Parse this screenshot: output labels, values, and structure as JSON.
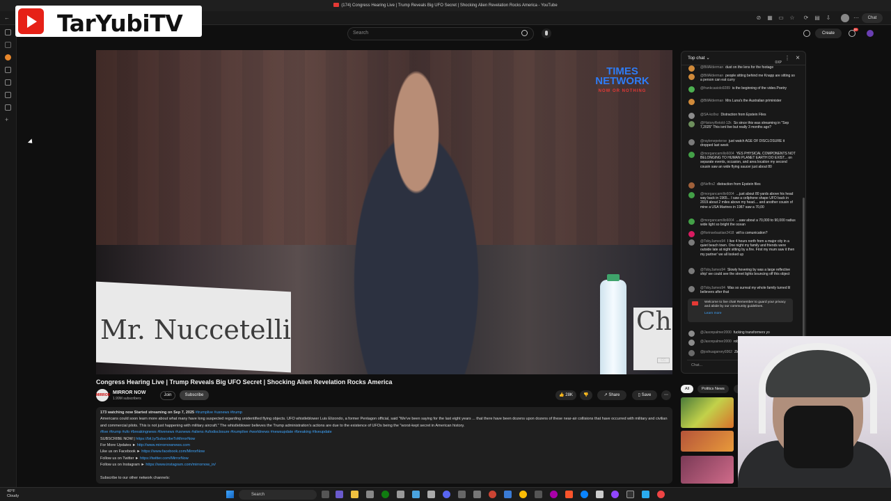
{
  "browser": {
    "window_title": "(174) Congress Hearing Live | Trump Reveals Big UFO Secret | Shocking Alien Revelation Rocks America - YouTube",
    "chat_button": "Chat"
  },
  "overlay": {
    "brand": "TarYubiTV"
  },
  "header": {
    "search_placeholder": "Search",
    "create_label": "Create",
    "notifications_count": "9+"
  },
  "video": {
    "nameplate": "Mr. Nuccetelli",
    "network_logo": "TIMES NETWORK",
    "network_tagline": "NOW OR NOTHING",
    "nameplate_partial": "Ch",
    "title": "Congress Hearing Live | Trump Reveals Big UFO Secret | Shocking Alien Revelation Rocks America"
  },
  "channel": {
    "avatar_text": "MIRROR",
    "name": "MIRROR NOW",
    "subscribers": "1.99M subscribers",
    "join_label": "Join",
    "subscribe_label": "Subscribe"
  },
  "actions": {
    "likes": "28K",
    "share_label": "Share",
    "save_label": "Save"
  },
  "description": {
    "meta": "173 watching now  Started streaming on Sep 7, 2025",
    "hashtags_top": "#trumplive #usnews #trump",
    "body": "Americans could soon learn more about what many have long suspected regarding unidentified flying objects. UFO whistleblower Luis Elizondo, a former Pentagon official, said \"We've been saying for the last eight years ... that there have been dozens upon dozens of these near-air collisions that have occurred with military and civilian and commercial pilots. This is not just happening with military aircraft.\" The whistleblower believes the Trump administration's actions are due to the existence of UFOs being the \"worst-kept secret in American history.",
    "hashtags": "#live #trump #ufo #breakingnews #livenews #usnews #aliens #ufodisclosure #trumplive #worldnews #newsupdate #breaking #liveupdate",
    "links": [
      {
        "label": "SUBSCRIBE NOW |",
        "url": "https://bit.ly/SubscribeToMirrorNow"
      },
      {
        "label": "For More Updates ►",
        "url": "http://www.mirrornownews.com"
      },
      {
        "label": "Like us on Facebook ►",
        "url": "https://www.facebook.com/MirrorNow"
      },
      {
        "label": "Follow us on Twitter ►",
        "url": "https://twitter.com/MirrorNow"
      },
      {
        "label": "Follow us on Instagram ►",
        "url": "https://www.instagram.com/mirrornow_in/"
      }
    ],
    "footer": "Subscribe to our other network channels:"
  },
  "chat": {
    "header": "Top chat",
    "xp": "0XP",
    "input_placeholder": "Chat...",
    "banner_text": "Welcome to live chat! Remember to guard your privacy and abide by our community guidelines.",
    "banner_link": "Learn more",
    "messages": [
      {
        "author": "@BillAlderman",
        "text": "dust on the lens for the footage",
        "color": "#d08a3a"
      },
      {
        "author": "@BillAlderman",
        "text": "people sitting behind me Knapp are sitting so a person can eat curry",
        "color": "#d08a3a"
      },
      {
        "author": "@frankcasiolo9289",
        "text": "is the beginning of the video.Poetry",
        "color": "#4caf50"
      },
      {
        "author": "@BillAlderman",
        "text": "Mrs Luna's the Australian priminister",
        "color": "#d08a3a"
      },
      {
        "author": "@SA-ko9vz",
        "text": "Distraction from Epstein Files",
        "color": "#8c8c8c"
      },
      {
        "author": "@HistoryRetold-12k",
        "text": "So since this was streaming in \"Sep 7,2025\" This isnt live but really 3 months ago?",
        "color": "#6d8f5c"
      },
      {
        "author": "@raylenepeterse",
        "text": "just watch AGE OF DISCLOSURE it dropped last week",
        "color": "#7a7a7a"
      },
      {
        "author": "@morgancamillo6004",
        "text": "YES PHYSICAL COMPONENTS NOT BELONGING TO HUMAN PLANET EARTH DO EXIST... on separate events, occasion, and area location my second cousin saw an wide flying saucer just about 80",
        "color": "#43a047"
      },
      {
        "author": "@Neffrs2",
        "text": "distraction from Epstein files",
        "color": "#a0603a"
      },
      {
        "author": "@morgancamillo6004",
        "text": "...just about 80 yards above his head way back in 1965... I saw a cellphone shape UFO back in 2019 about 2 miles above my head.... and another cousin of mine a USA Marines in 1987 saw a 70,00",
        "color": "#43a047"
      },
      {
        "author": "@morgancamillo6004",
        "text": "...saw about a 70,000 to 90,000 radius wide light so bright the ocean",
        "color": "#43a047"
      },
      {
        "author": "@florinsebastian2418",
        "text": "wtf is comunication?",
        "color": "#d81b60"
      },
      {
        "author": "@TobyJames94",
        "text": "I live 4 hours north from a major city in a quiet beach town. One night my family and friends were outside late at night sitting by a fire. First my mum saw it then my partner' we all looked up",
        "color": "#7a7a7a"
      },
      {
        "author": "@TobyJames94",
        "text": "Slowly hovering by was a large reflective ship' we could see the street lights bouncing off this object",
        "color": "#7a7a7a"
      },
      {
        "author": "@TobyJames94",
        "text": "Was so surreal my whole family turned lil believers after that",
        "color": "#7a7a7a"
      },
      {
        "author": "@Jasonpalmer2000",
        "text": "fucking transformers yo",
        "color": "#8c8c8c"
      },
      {
        "author": "@Jasonpalmer2000",
        "text": "robots aliens satan hell yo",
        "color": "#8c8c8c"
      },
      {
        "author": "@joshuagarvey9362",
        "text": "Zimbabwe",
        "color": "#6a6a6a"
      }
    ]
  },
  "recommendations": {
    "chips": [
      "All",
      "Politics News",
      "Related"
    ]
  },
  "taskbar": {
    "temp": "40°F",
    "weather": "Cloudy",
    "search_label": "Search"
  }
}
